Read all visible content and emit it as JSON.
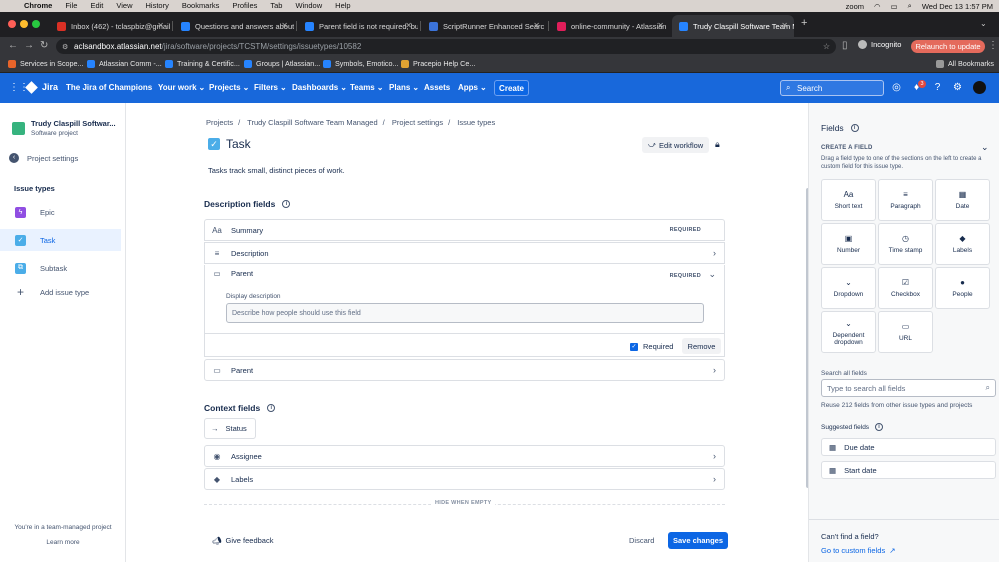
{
  "macbar": {
    "apple": "",
    "app": "Chrome",
    "menus": [
      "File",
      "Edit",
      "View",
      "History",
      "Bookmarks",
      "Profiles",
      "Tab",
      "Window",
      "Help"
    ],
    "zoom": "zoom",
    "datetime": "Wed Dec 13  1:57 PM"
  },
  "tabs": [
    {
      "label": "Inbox (462) - tclaspbiz@gmail",
      "color": "#d93025"
    },
    {
      "label": "Questions and answers about",
      "color": "#2684ff"
    },
    {
      "label": "Parent field is not required, bu",
      "color": "#2684ff"
    },
    {
      "label": "ScriptRunner Enhanced Searc",
      "color": "#3b73d9"
    },
    {
      "label": "online-community - Atlassian",
      "color": "#e01e5a"
    },
    {
      "label": "Trudy Claspill Software Team M",
      "color": "#2684ff"
    }
  ],
  "address": {
    "host": "aclsandbox.atlassian.net",
    "path": "/jira/software/projects/TCSTM/settings/issuetypes/10582",
    "incognito": "Incognito",
    "relaunch": "Relaunch to update"
  },
  "bookmarks": [
    "Services in Scope...",
    "Atlassian Comm -...",
    "Training & Certific...",
    "Groups | Atlassian...",
    "Symbols, Emotico...",
    "Pracepio Help Ce..."
  ],
  "all_bookmarks": "All Bookmarks",
  "jira_nav": {
    "logo": "Jira",
    "site": "The Jira of Champions",
    "items": [
      "Your work",
      "Projects",
      "Filters",
      "Dashboards",
      "Teams",
      "Plans",
      "Assets",
      "Apps"
    ],
    "create": "Create",
    "search_placeholder": "Search",
    "notif_count": "3"
  },
  "sidebar": {
    "project_name": "Trudy Claspill Software Team Managed",
    "project_name_short": "Trudy Claspill Softwar...",
    "project_type": "Software project",
    "back": "Project settings",
    "section": "Issue types",
    "items": [
      {
        "label": "Epic",
        "color": "#904ee2"
      },
      {
        "label": "Task",
        "color": "#4bade8"
      },
      {
        "label": "Subtask",
        "color": "#4bade8"
      },
      {
        "label": "Add issue type",
        "color": "#44546f"
      }
    ],
    "footer": "You're in a team-managed project",
    "learn_more": "Learn more"
  },
  "breadcrumbs": [
    "Projects",
    "/",
    "Trudy Claspill Software Team Managed",
    "/",
    "Project settings",
    "/",
    "Issue types"
  ],
  "issue_type": {
    "title": "Task",
    "description": "Tasks track small, distinct pieces of work.",
    "edit_workflow": "Edit workflow"
  },
  "description_fields": {
    "heading": "Description fields",
    "rows": [
      {
        "label": "Summary",
        "badge": "REQUIRED",
        "icon": "Aa"
      },
      {
        "label": "Description",
        "badge": "",
        "icon": "≡"
      },
      {
        "label": "Parent",
        "badge": "REQUIRED",
        "icon": "▭"
      }
    ],
    "display_description_label": "Display description",
    "display_description_placeholder": "Describe how people should use this field",
    "required_label": "Required",
    "remove_label": "Remove",
    "parent_row": "Parent"
  },
  "context_fields": {
    "heading": "Context fields",
    "status": "Status",
    "rows": [
      "Assignee",
      "Labels"
    ],
    "hide_when_empty": "HIDE WHEN EMPTY"
  },
  "footer": {
    "feedback": "Give feedback",
    "discard": "Discard",
    "save": "Save changes"
  },
  "fields_panel": {
    "title": "Fields",
    "create_heading": "CREATE A FIELD",
    "create_help": "Drag a field type to one of the sections on the left to create a custom field for this issue type.",
    "tiles": [
      {
        "label": "Short text",
        "icon": "Aa"
      },
      {
        "label": "Paragraph",
        "icon": "≡"
      },
      {
        "label": "Date",
        "icon": "▦"
      },
      {
        "label": "Number",
        "icon": "▣"
      },
      {
        "label": "Time stamp",
        "icon": "◷"
      },
      {
        "label": "Labels",
        "icon": "◆"
      },
      {
        "label": "Dropdown",
        "icon": "⌄"
      },
      {
        "label": "Checkbox",
        "icon": "☑"
      },
      {
        "label": "People",
        "icon": "●"
      },
      {
        "label": "Dependent dropdown",
        "icon": "⌄"
      },
      {
        "label": "URL",
        "icon": "▭"
      }
    ],
    "search_heading": "Search all fields",
    "search_placeholder": "Type to search all fields",
    "reuse_text": "Reuse 212 fields from other issue types and projects",
    "suggested_heading": "Suggested fields",
    "suggested": [
      "Due date",
      "Start date"
    ],
    "cant_find": "Can't find a field?",
    "custom_link": "Go to custom fields"
  }
}
